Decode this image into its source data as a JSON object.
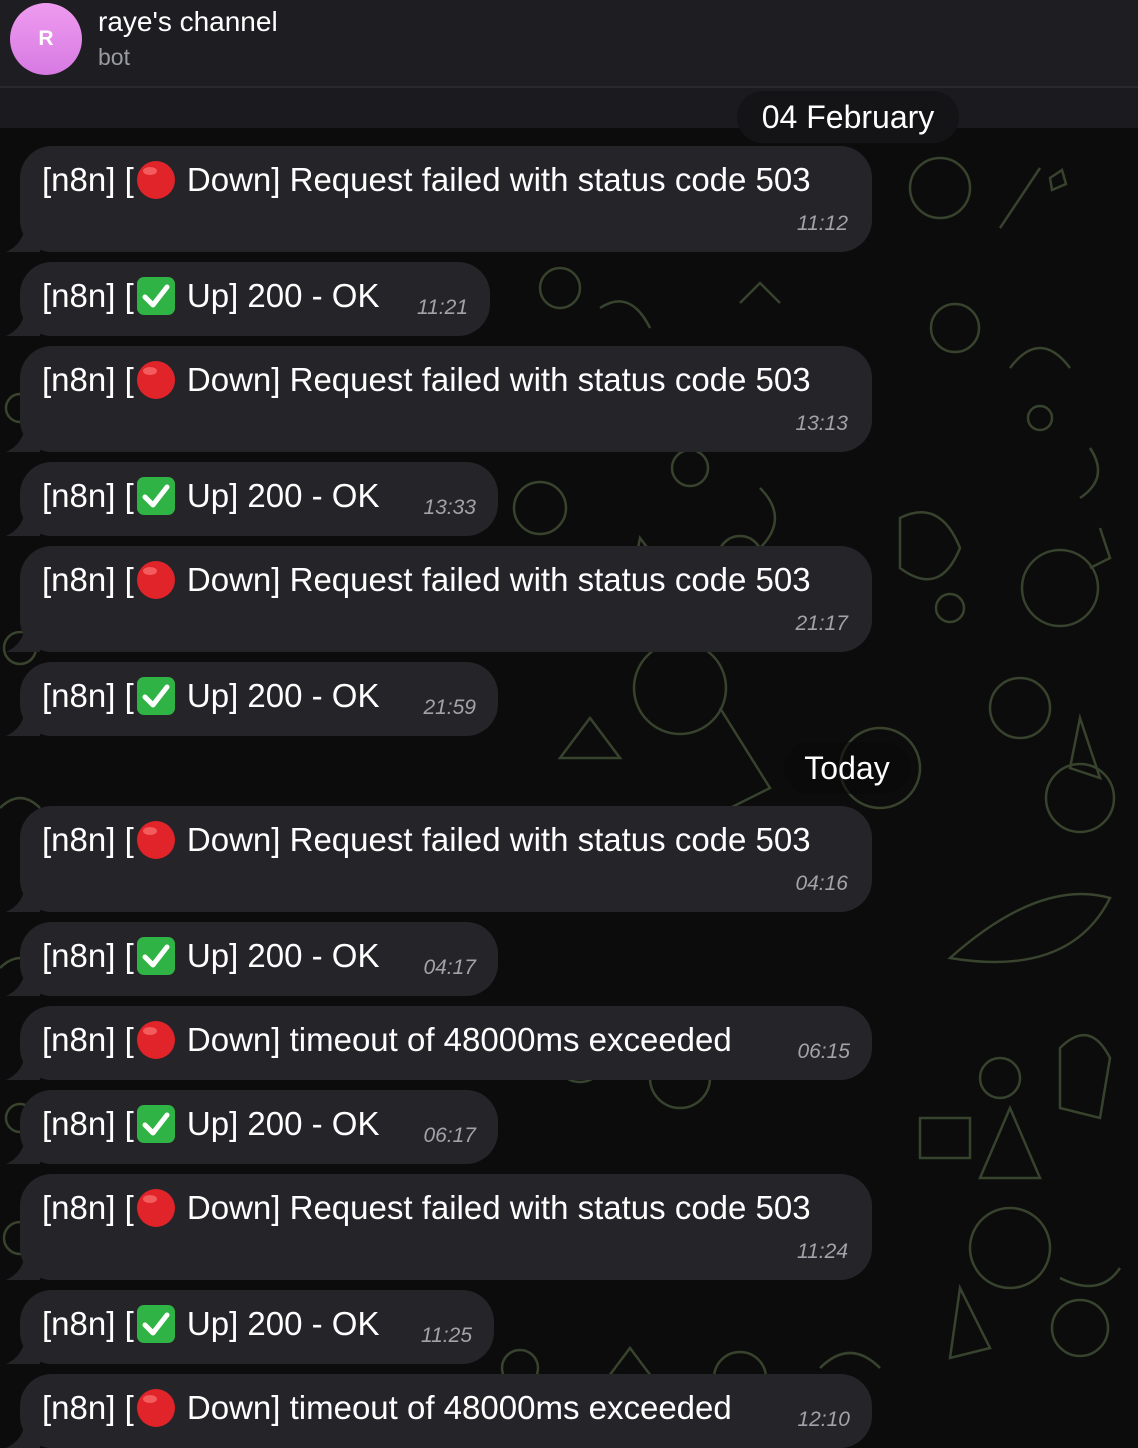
{
  "header": {
    "avatar_letter": "R",
    "title": "raye's channel",
    "subtitle": "bot"
  },
  "date_separators": [
    "04 February",
    "Today"
  ],
  "icons": {
    "down": "red-circle-icon",
    "up": "green-check-icon"
  },
  "colors": {
    "avatar": "#e08ae8",
    "bubble": "#252529",
    "down": "#e1242a",
    "up": "#2fb344"
  },
  "messages": [
    {
      "prefix": "[n8n] [",
      "status": "down",
      "text": " Down] Request failed with status code 503",
      "time": "11:12"
    },
    {
      "prefix": "[n8n] [",
      "status": "up",
      "text": " Up] 200 - OK",
      "time": "11:21"
    },
    {
      "prefix": "[n8n] [",
      "status": "down",
      "text": " Down] Request failed with status code 503",
      "time": "13:13"
    },
    {
      "prefix": "[n8n] [",
      "status": "up",
      "text": " Up] 200 - OK",
      "time": "13:33"
    },
    {
      "prefix": "[n8n] [",
      "status": "down",
      "text": " Down] Request failed with status code 503",
      "time": "21:17"
    },
    {
      "prefix": "[n8n] [",
      "status": "up",
      "text": " Up] 200 - OK",
      "time": "21:59"
    },
    {
      "prefix": "[n8n] [",
      "status": "down",
      "text": " Down] Request failed with status code 503",
      "time": "04:16"
    },
    {
      "prefix": "[n8n] [",
      "status": "up",
      "text": " Up] 200 - OK",
      "time": "04:17"
    },
    {
      "prefix": "[n8n] [",
      "status": "down",
      "text": " Down] timeout of 48000ms exceeded",
      "time": "06:15"
    },
    {
      "prefix": "[n8n] [",
      "status": "up",
      "text": " Up] 200 - OK",
      "time": "06:17"
    },
    {
      "prefix": "[n8n] [",
      "status": "down",
      "text": " Down] Request failed with status code 503",
      "time": "11:24"
    },
    {
      "prefix": "[n8n] [",
      "status": "up",
      "text": " Up] 200 - OK",
      "time": "11:25"
    },
    {
      "prefix": "[n8n] [",
      "status": "down",
      "text": " Down] timeout of 48000ms exceeded",
      "time": "12:10"
    }
  ]
}
